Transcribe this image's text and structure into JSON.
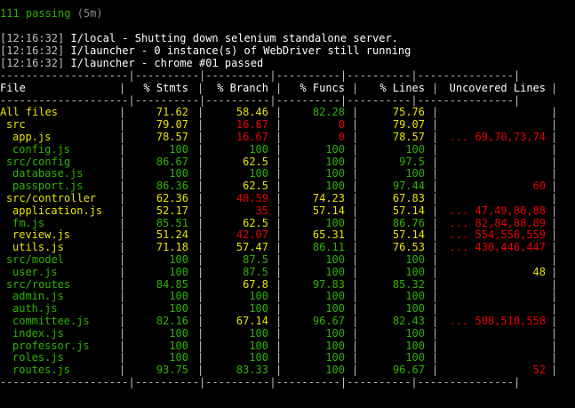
{
  "summary": {
    "passing": "111 passing",
    "duration": "(5m)"
  },
  "logs": [
    {
      "ts": "[12:16:32]",
      "msg": " I/local - Shutting down selenium standalone server."
    },
    {
      "ts": "[12:16:32]",
      "msg": " I/launcher - 0 instance(s) of WebDriver still running"
    },
    {
      "ts": "[12:16:32]",
      "msg": " I/launcher - chrome #01 passed"
    }
  ],
  "colors": {
    "good": "#2db400",
    "medium": "#e5e500",
    "low": "#e50000",
    "header": "#ffffff",
    "background": "#000000"
  },
  "table": {
    "headers": {
      "file": "File",
      "stmts": "% Stmts",
      "branch": "% Branch",
      "funcs": "% Funcs",
      "lines": "% Lines",
      "uncovered": "Uncovered Lines"
    },
    "separator": "--------------------|----------|----------|----------|----------|---------------|",
    "rows": [
      {
        "file": "All files",
        "indent": 0,
        "fc": "y",
        "stmts": "71.62",
        "sc": "y",
        "branch": "58.46",
        "bc": "y",
        "funcs": "82.28",
        "fnc": "g",
        "lines": "75.76",
        "lc": "y",
        "unc": "",
        "uc": "w"
      },
      {
        "file": "src",
        "indent": 1,
        "fc": "y",
        "stmts": "79.07",
        "sc": "y",
        "branch": "16.67",
        "bc": "r",
        "funcs": "0",
        "fnc": "r",
        "lines": "79.07",
        "lc": "y",
        "unc": "",
        "uc": "w"
      },
      {
        "file": "app.js",
        "indent": 2,
        "fc": "y",
        "stmts": "78.57",
        "sc": "y",
        "branch": "16.67",
        "bc": "r",
        "funcs": "0",
        "fnc": "r",
        "lines": "78.57",
        "lc": "y",
        "unc": "... 69,70,73,74",
        "uc": "r"
      },
      {
        "file": "config.js",
        "indent": 2,
        "fc": "g",
        "stmts": "100",
        "sc": "g",
        "branch": "100",
        "bc": "g",
        "funcs": "100",
        "fnc": "g",
        "lines": "100",
        "lc": "g",
        "unc": "",
        "uc": "w"
      },
      {
        "file": "src/config",
        "indent": 1,
        "fc": "g",
        "stmts": "86.67",
        "sc": "g",
        "branch": "62.5",
        "bc": "y",
        "funcs": "100",
        "fnc": "g",
        "lines": "97.5",
        "lc": "g",
        "unc": "",
        "uc": "w"
      },
      {
        "file": "database.js",
        "indent": 2,
        "fc": "g",
        "stmts": "100",
        "sc": "g",
        "branch": "100",
        "bc": "g",
        "funcs": "100",
        "fnc": "g",
        "lines": "100",
        "lc": "g",
        "unc": "",
        "uc": "w"
      },
      {
        "file": "passport.js",
        "indent": 2,
        "fc": "g",
        "stmts": "86.36",
        "sc": "g",
        "branch": "62.5",
        "bc": "y",
        "funcs": "100",
        "fnc": "g",
        "lines": "97.44",
        "lc": "g",
        "unc": "60",
        "uc": "r"
      },
      {
        "file": "src/controller",
        "indent": 1,
        "fc": "y",
        "stmts": "62.36",
        "sc": "y",
        "branch": "48.59",
        "bc": "r",
        "funcs": "74.23",
        "fnc": "y",
        "lines": "67.83",
        "lc": "y",
        "unc": "",
        "uc": "w"
      },
      {
        "file": "application.js",
        "indent": 2,
        "fc": "y",
        "stmts": "52.17",
        "sc": "y",
        "branch": "35",
        "bc": "r",
        "funcs": "57.14",
        "fnc": "y",
        "lines": "57.14",
        "lc": "y",
        "unc": "... 47,49,86,88",
        "uc": "r"
      },
      {
        "file": "fm.js",
        "indent": 2,
        "fc": "g",
        "stmts": "85.51",
        "sc": "g",
        "branch": "62.5",
        "bc": "y",
        "funcs": "100",
        "fnc": "g",
        "lines": "86.76",
        "lc": "g",
        "unc": "... 82,84,88,89",
        "uc": "r"
      },
      {
        "file": "review.js",
        "indent": 2,
        "fc": "y",
        "stmts": "51.24",
        "sc": "y",
        "branch": "42.07",
        "bc": "r",
        "funcs": "65.31",
        "fnc": "y",
        "lines": "57.14",
        "lc": "y",
        "unc": "... 554,556,559",
        "uc": "r"
      },
      {
        "file": "utils.js",
        "indent": 2,
        "fc": "y",
        "stmts": "71.18",
        "sc": "y",
        "branch": "57.47",
        "bc": "y",
        "funcs": "86.11",
        "fnc": "g",
        "lines": "76.53",
        "lc": "y",
        "unc": "... 430,446,447",
        "uc": "r"
      },
      {
        "file": "src/model",
        "indent": 1,
        "fc": "g",
        "stmts": "100",
        "sc": "g",
        "branch": "87.5",
        "bc": "g",
        "funcs": "100",
        "fnc": "g",
        "lines": "100",
        "lc": "g",
        "unc": "",
        "uc": "w"
      },
      {
        "file": "user.js",
        "indent": 2,
        "fc": "g",
        "stmts": "100",
        "sc": "g",
        "branch": "87.5",
        "bc": "g",
        "funcs": "100",
        "fnc": "g",
        "lines": "100",
        "lc": "g",
        "unc": "48",
        "uc": "y"
      },
      {
        "file": "src/routes",
        "indent": 1,
        "fc": "g",
        "stmts": "84.85",
        "sc": "g",
        "branch": "67.8",
        "bc": "y",
        "funcs": "97.83",
        "fnc": "g",
        "lines": "85.32",
        "lc": "g",
        "unc": "",
        "uc": "w"
      },
      {
        "file": "admin.js",
        "indent": 2,
        "fc": "g",
        "stmts": "100",
        "sc": "g",
        "branch": "100",
        "bc": "g",
        "funcs": "100",
        "fnc": "g",
        "lines": "100",
        "lc": "g",
        "unc": "",
        "uc": "w"
      },
      {
        "file": "auth.js",
        "indent": 2,
        "fc": "g",
        "stmts": "100",
        "sc": "g",
        "branch": "100",
        "bc": "g",
        "funcs": "100",
        "fnc": "g",
        "lines": "100",
        "lc": "g",
        "unc": "",
        "uc": "w"
      },
      {
        "file": "committee.js",
        "indent": 2,
        "fc": "g",
        "stmts": "82.16",
        "sc": "g",
        "branch": "67.14",
        "bc": "y",
        "funcs": "96.67",
        "fnc": "g",
        "lines": "82.43",
        "lc": "g",
        "unc": "... 508,510,558",
        "uc": "r"
      },
      {
        "file": "index.js",
        "indent": 2,
        "fc": "g",
        "stmts": "100",
        "sc": "g",
        "branch": "100",
        "bc": "g",
        "funcs": "100",
        "fnc": "g",
        "lines": "100",
        "lc": "g",
        "unc": "",
        "uc": "w"
      },
      {
        "file": "professor.js",
        "indent": 2,
        "fc": "g",
        "stmts": "100",
        "sc": "g",
        "branch": "100",
        "bc": "g",
        "funcs": "100",
        "fnc": "g",
        "lines": "100",
        "lc": "g",
        "unc": "",
        "uc": "w"
      },
      {
        "file": "roles.js",
        "indent": 2,
        "fc": "g",
        "stmts": "100",
        "sc": "g",
        "branch": "100",
        "bc": "g",
        "funcs": "100",
        "fnc": "g",
        "lines": "100",
        "lc": "g",
        "unc": "",
        "uc": "w"
      },
      {
        "file": "routes.js",
        "indent": 2,
        "fc": "g",
        "stmts": "93.75",
        "sc": "g",
        "branch": "83.33",
        "bc": "g",
        "funcs": "100",
        "fnc": "g",
        "lines": "96.67",
        "lc": "g",
        "unc": "52",
        "uc": "r"
      }
    ]
  }
}
